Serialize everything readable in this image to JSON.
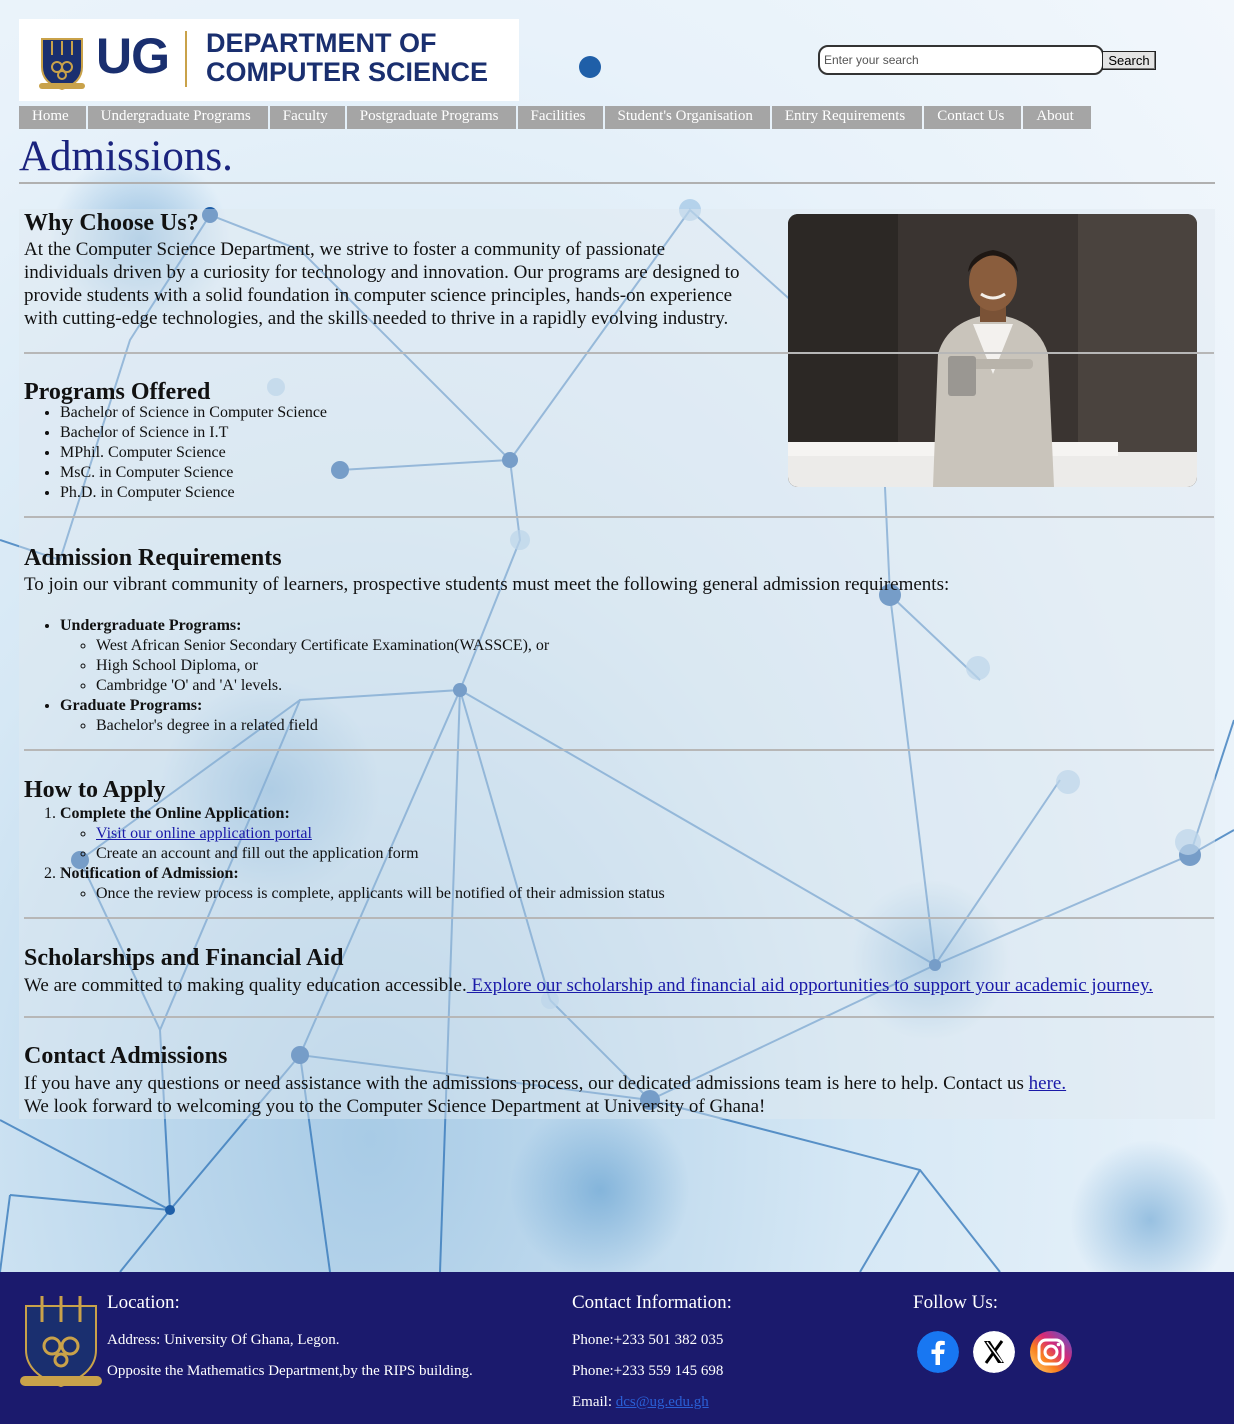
{
  "header": {
    "logo_initials": "UG",
    "logo_line1": "DEPARTMENT OF",
    "logo_line2": "COMPUTER SCIENCE",
    "search_placeholder": "Enter your search",
    "search_button": "Search"
  },
  "nav": [
    "Home",
    "Undergraduate Programs",
    "Faculty",
    "Postgraduate Programs",
    "Facilities",
    "Student's Organisation",
    "Entry Requirements",
    "Contact Us",
    "About"
  ],
  "page_title": "Admissions.",
  "why": {
    "heading": "Why Choose Us?",
    "lines": [
      "At the Computer Science Department, we strive to foster a community of passionate",
      "individuals driven by a curiosity for technology and innovation. Our programs are designed to",
      "provide students with a solid foundation in computer science principles, hands-on experience",
      "with cutting-edge technologies, and the skills needed to thrive in a rapidly evolving industry."
    ]
  },
  "programs": {
    "heading": "Programs Offered",
    "items": [
      "Bachelor of Science in Computer Science",
      "Bachelor of Science in I.T",
      "MPhil. Computer Science",
      "MsC. in Computer Science",
      "Ph.D. in Computer Science"
    ]
  },
  "requirements": {
    "heading": "Admission Requirements",
    "intro": "To join our vibrant community of learners, prospective students must meet the following general admission requirements:",
    "undergrad_label": "Undergraduate Programs:",
    "undergrad_items": [
      "West African Senior Secondary Certificate Examination(WASSCE), or",
      "High School Diploma, or",
      "Cambridge 'O' and 'A' levels."
    ],
    "grad_label": "Graduate Programs:",
    "grad_items": [
      "Bachelor's degree in a related field"
    ]
  },
  "apply": {
    "heading": "How to Apply",
    "step1": "Complete the Online Application:",
    "step1_link": "Visit our online application portal",
    "step1_text": "Create an account and fill out the application form",
    "step2": "Notification of Admission:",
    "step2_text": "Once the review process is complete, applicants will be notified of their admission status"
  },
  "scholarships": {
    "heading": "Scholarships and Financial Aid",
    "text": "We are committed to making quality education accessible.",
    "link": " Explore our scholarship and financial aid opportunities to support your academic journey."
  },
  "contact": {
    "heading": "Contact Admissions",
    "text": "If you have any questions or need assistance with the admissions process, our dedicated admissions team is here to help. Contact us ",
    "link": "here.",
    "closing": "We look forward to welcoming you to the Computer Science Department at University of Ghana!"
  },
  "footer": {
    "location_heading": "Location:",
    "address1": "Address: University Of Ghana, Legon.",
    "address2": "Opposite the Mathematics Department,by the RIPS building.",
    "contact_heading": "Contact Information:",
    "phone1": "Phone:+233 501 382 035",
    "phone2": "Phone:+233 559 145 698",
    "email_label": "Email:",
    "email": "dcs@ug.edu.gh",
    "follow_heading": "Follow Us:",
    "social": [
      "facebook-icon",
      "x-icon",
      "instagram-icon"
    ]
  },
  "colors": {
    "brand_navy": "#1a2f6f",
    "title_blue": "#1a237e",
    "footer_bg": "#1b1a6d",
    "nav_gray": "#a5a5a5",
    "accent_gold": "#c9a24a"
  }
}
